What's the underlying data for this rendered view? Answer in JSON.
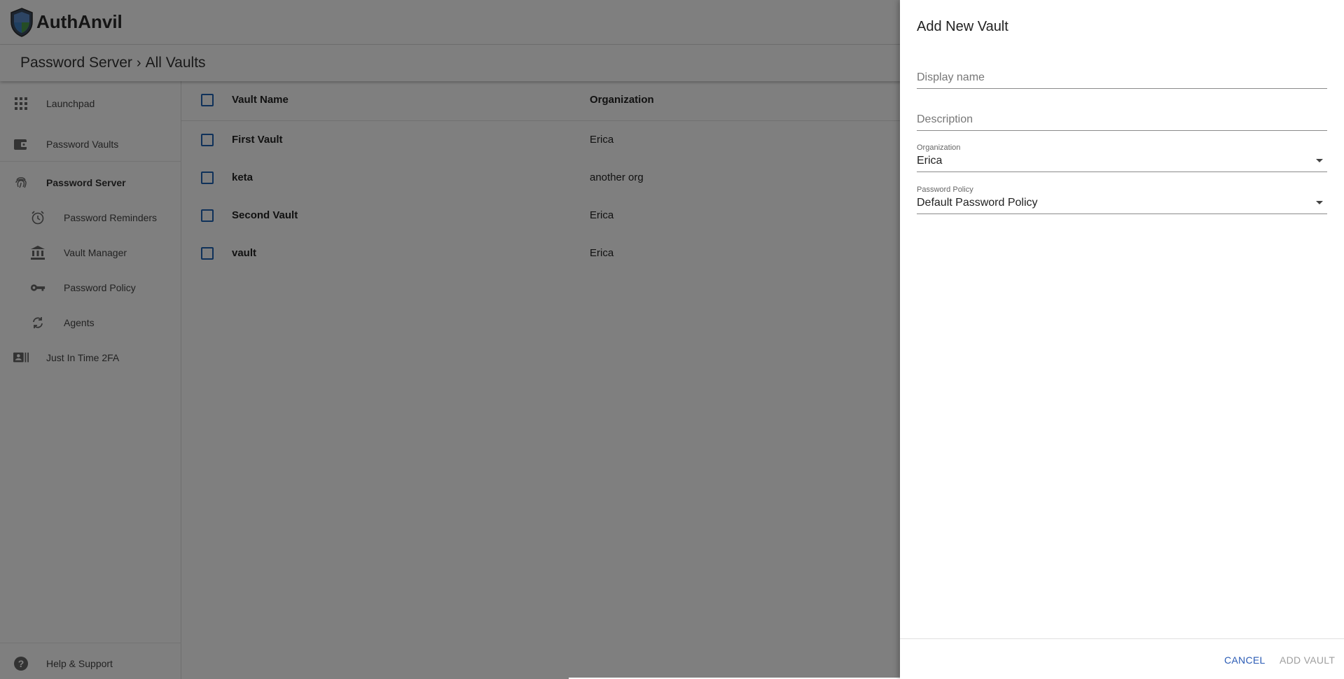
{
  "app": {
    "name": "AuthAnvil"
  },
  "breadcrumb": {
    "parent": "Password Server",
    "current": "All Vaults"
  },
  "sidebar": {
    "items": [
      {
        "label": "Launchpad",
        "icon": "grid-icon"
      },
      {
        "label": "Password Vaults",
        "icon": "wallet-icon"
      },
      {
        "label": "Password Server",
        "icon": "fingerprint-icon"
      },
      {
        "label": "Password Reminders",
        "icon": "alarm-icon"
      },
      {
        "label": "Vault Manager",
        "icon": "bank-icon"
      },
      {
        "label": "Password Policy",
        "icon": "key-icon"
      },
      {
        "label": "Agents",
        "icon": "sync-icon"
      },
      {
        "label": "Just In Time 2FA",
        "icon": "id-card-icon"
      }
    ],
    "footer": {
      "label": "Help & Support",
      "icon": "help-icon"
    }
  },
  "table": {
    "columns": [
      "Vault Name",
      "Organization"
    ],
    "rows": [
      {
        "name": "First Vault",
        "org": "Erica"
      },
      {
        "name": "keta",
        "org": "another org"
      },
      {
        "name": "Second Vault",
        "org": "Erica"
      },
      {
        "name": "vault",
        "org": "Erica"
      }
    ]
  },
  "dialog": {
    "title": "Add New Vault",
    "display_name": {
      "placeholder": "Display name",
      "value": ""
    },
    "description": {
      "placeholder": "Description",
      "value": ""
    },
    "organization": {
      "label": "Organization",
      "value": "Erica"
    },
    "password_policy": {
      "label": "Password Policy",
      "value": "Default Password Policy"
    },
    "cancel_label": "CANCEL",
    "add_label": "ADD VAULT"
  },
  "colors": {
    "accent": "#2a5bb5",
    "checkbox": "#1e63b5",
    "disabled": "#9e9e9e"
  }
}
